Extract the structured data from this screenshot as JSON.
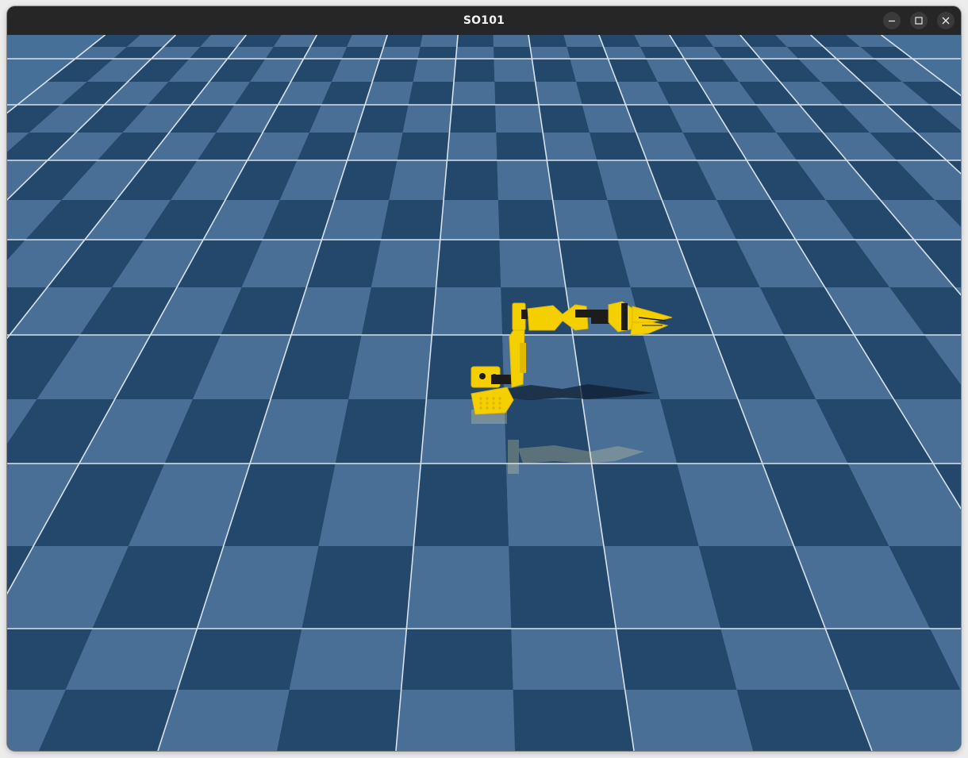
{
  "window": {
    "title": "SO101",
    "controls": {
      "minimize_icon": "minimize-icon",
      "maximize_icon": "maximize-icon",
      "close_icon": "close-icon"
    }
  },
  "scene": {
    "floor": "checkerboard",
    "colors": {
      "tile_light": "#4a6f97",
      "tile_dark": "#24486c",
      "grid_line": "#d8e2ec",
      "robot": "#f5d000",
      "robot_shadow": "#e0b800",
      "robot_joint": "#1c1c1c"
    }
  }
}
